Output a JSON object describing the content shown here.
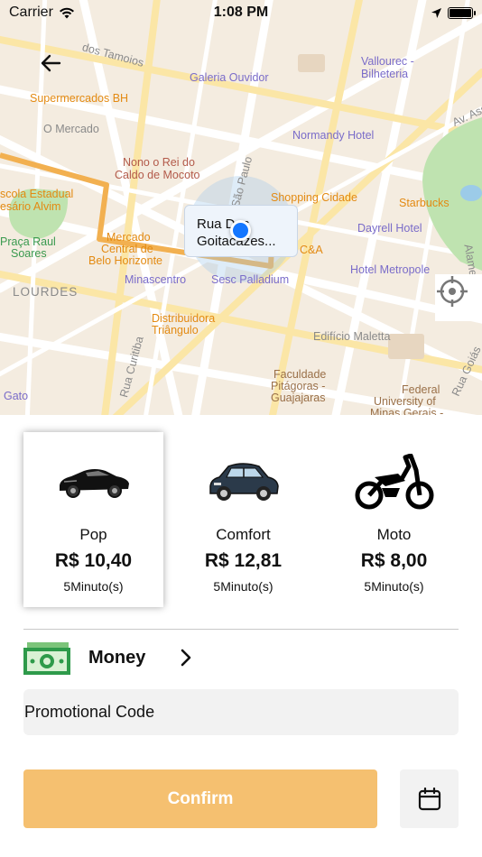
{
  "status_bar": {
    "carrier": "Carrier",
    "time": "1:08 PM"
  },
  "map": {
    "labels": {
      "galeria": "Galeria Ouvidor",
      "vallourec": "Vallourec -",
      "bilheteria": "Bilheteria",
      "supermercados": "Supermercados BH",
      "o_mercado": "O Mercado",
      "normandy": "Normandy Hotel",
      "av_assis": "Av. Assis",
      "nono1": "Nono o Rei do",
      "nono2": "Caldo de Mocoto",
      "escola1": "scola Estadual",
      "escola2": "esário Alvim",
      "shopping": "Shopping Cidade",
      "starbucks": "Starbucks",
      "praca1": "Praça Raul",
      "praca2": "Soares",
      "mercado1": "Mercado",
      "mercado2": "Central de",
      "mercado3": "Belo Horizonte",
      "ca": "C&A",
      "dayrell": "Dayrell Hotel",
      "lourdes": "LOURDES",
      "minascentro": "Minascentro",
      "sesc": "Sesc Palladium",
      "metropole": "Hotel Metropole",
      "distribuidora1": "Distribuidora",
      "distribuidora2": "Triângulo",
      "maletta": "Edifício Maletta",
      "faculdade1": "Faculdade",
      "faculdade2": "Pitágoras -",
      "faculdade3": "Guajajaras",
      "federal1": "Federal",
      "federal2": "University of",
      "federal3": "Minas Gerais -",
      "gato": "Gato",
      "rua_curitiba": "Rua Curitiba",
      "sao_paulo": "São Paulo",
      "rua_goias": "Rua Goiás",
      "alameda": "Alamed",
      "tamoios": "dos Tamoios"
    },
    "callout_text": "Rua Dos Goitacazes..."
  },
  "vehicles": [
    {
      "name": "Pop",
      "price": "R$ 10,40",
      "time": "5Minuto(s)",
      "icon": "sports-car-icon",
      "selected": true
    },
    {
      "name": "Comfort",
      "price": "R$ 12,81",
      "time": "5Minuto(s)",
      "icon": "sedan-car-icon",
      "selected": false
    },
    {
      "name": "Moto",
      "price": "R$ 8,00",
      "time": "5Minuto(s)",
      "icon": "motorcycle-icon",
      "selected": false
    }
  ],
  "payment": {
    "label": "Money",
    "icon": "money-bill-icon"
  },
  "promo": {
    "placeholder": "Promotional Code",
    "value": ""
  },
  "confirm": {
    "label": "Confirm"
  },
  "colors": {
    "accent": "#f5c070",
    "pin": "#1577ff",
    "route": "#f2b050"
  }
}
